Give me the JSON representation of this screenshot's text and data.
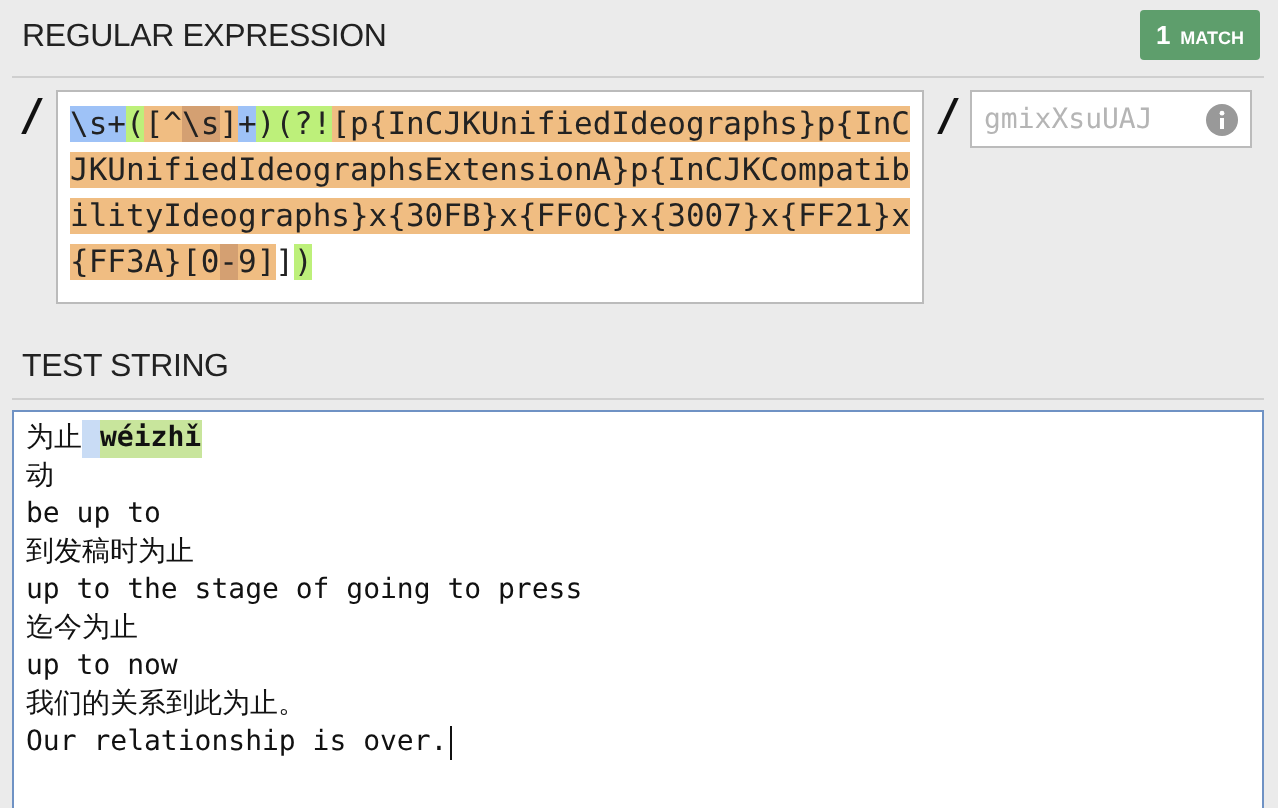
{
  "regex_section": {
    "title": "REGULAR EXPRESSION",
    "match_badge": {
      "count": "1",
      "label": "MATCH"
    },
    "delimiter_open": "/",
    "delimiter_close": "/",
    "pattern_tokens": [
      {
        "text": "\\s+",
        "kind": "quantified"
      },
      {
        "text": "(",
        "kind": "group"
      },
      {
        "text": "[^",
        "kind": "class"
      },
      {
        "text": "\\s",
        "kind": "class_escape"
      },
      {
        "text": "]",
        "kind": "class"
      },
      {
        "text": "+",
        "kind": "quantified"
      },
      {
        "text": ")(?!",
        "kind": "group"
      },
      {
        "text": "[p{InCJKUnifiedIdeographs}p{InCJKUnifiedIdeographsExtensionA}p{InCJKCompatibilityIdeographs}x{30FB}x{FF0C}x{3007}x{FF21}x{FF3A}[0",
        "kind": "class"
      },
      {
        "text": "-",
        "kind": "class_escape"
      },
      {
        "text": "9]",
        "kind": "class"
      },
      {
        "text": "]",
        "kind": "plain"
      },
      {
        "text": ")",
        "kind": "group"
      }
    ],
    "flags_placeholder": "gmixXsuUAJ"
  },
  "test_section": {
    "title": "TEST STRING",
    "lines": [
      {
        "segments": [
          {
            "text": "为止",
            "kind": "plain"
          },
          {
            "text": "wéizhǐ",
            "kind": "match_group",
            "leading_space_matched": true
          }
        ]
      },
      {
        "segments": [
          {
            "text": "动",
            "kind": "plain"
          }
        ]
      },
      {
        "segments": [
          {
            "text": "be up to",
            "kind": "plain"
          }
        ]
      },
      {
        "segments": [
          {
            "text": "到发稿时为止",
            "kind": "plain"
          }
        ]
      },
      {
        "segments": [
          {
            "text": "up to the stage of going to press",
            "kind": "plain"
          }
        ]
      },
      {
        "segments": [
          {
            "text": "迄今为止",
            "kind": "plain"
          }
        ]
      },
      {
        "segments": [
          {
            "text": "up to now",
            "kind": "plain"
          }
        ]
      },
      {
        "segments": [
          {
            "text": "我们的关系到此为止。",
            "kind": "plain"
          }
        ]
      },
      {
        "segments": [
          {
            "text": "Our relationship is over.",
            "kind": "plain"
          }
        ],
        "caret": true
      }
    ]
  }
}
